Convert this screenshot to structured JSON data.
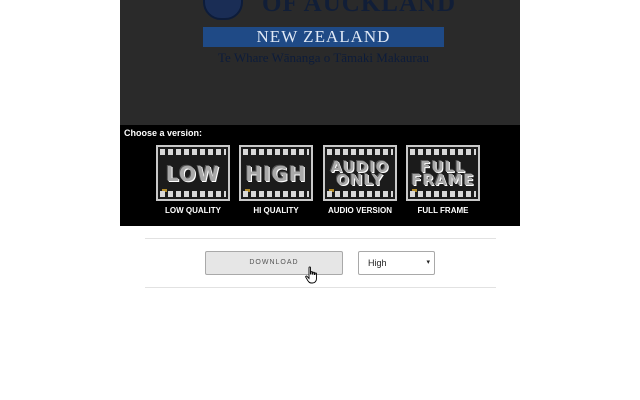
{
  "header": {
    "university_name": "OF AUCKLAND",
    "country": "NEW ZEALAND",
    "maori_name": "Te Whare Wānanga o Tāmaki Makaurau"
  },
  "chooser": {
    "prompt": "Choose a version:",
    "versions": [
      {
        "film_text": "LOW",
        "caption": "LOW QUALITY"
      },
      {
        "film_text": "HIGH",
        "caption": "HI QUALITY"
      },
      {
        "film_text_line1": "AUDIO",
        "film_text_line2": "ONLY",
        "caption": "AUDIO VERSION"
      },
      {
        "film_text_line1": "FULL",
        "film_text_line2": "FRAME",
        "caption": "FULL FRAME"
      }
    ]
  },
  "controls": {
    "download_label": "DOWNLOAD",
    "quality_selected": "High",
    "quality_chevron": "▾"
  },
  "icons": {
    "crest": "university-crest-icon",
    "cursor": "hand-pointer-icon"
  }
}
